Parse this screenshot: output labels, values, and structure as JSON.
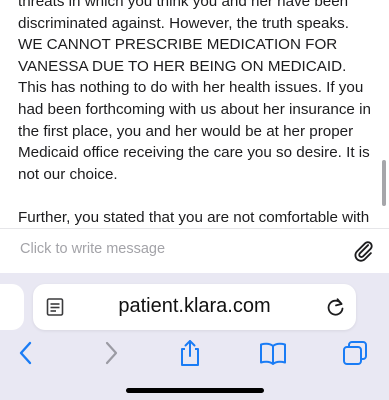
{
  "message": {
    "paragraphs": [
      "threats in which you think you and her have been discriminated against. However, the truth speaks. WE CANNOT PRESCRIBE MEDICATION FOR VANESSA DUE TO HER BEING ON MEDICAID. This has nothing to do with her health issues. If you had been forthcoming with us about her insurance in the first place, you and her would be at her proper Medicaid office receiving the care you so desire. It is not our choice.",
      "Further, you stated that you are not comfortable with your care with Dr Ermine due to her lack of knowledge regarding trauma. However, you seem to have forgotten that the"
    ]
  },
  "composer": {
    "placeholder": "Click to write message",
    "attach_icon": "paperclip-icon"
  },
  "browser": {
    "url": "patient.klara.com",
    "reader_icon": "reader-icon",
    "reload_icon": "reload-icon",
    "toolbar_icons": [
      "back-icon",
      "forward-icon",
      "share-icon",
      "bookmarks-icon",
      "tabs-icon"
    ],
    "accent_color": "#1a7cf5",
    "disabled_color": "#9b9ba3"
  }
}
